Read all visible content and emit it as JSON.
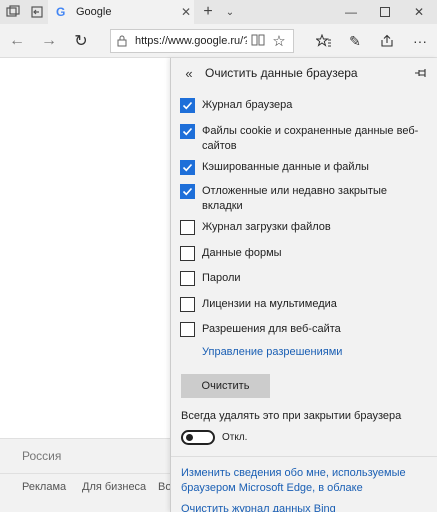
{
  "browser": {
    "tab": {
      "logo": "G",
      "title": "Google"
    },
    "address": {
      "url": "https://www.google.ru/?"
    }
  },
  "page": {
    "footer": {
      "country": "Россия",
      "links": [
        "Реклама",
        "Для бизнеса",
        "Во"
      ]
    }
  },
  "panel": {
    "title": "Очистить данные браузера",
    "checkboxes": [
      {
        "label": "Журнал браузера",
        "checked": true
      },
      {
        "label": "Файлы cookie и сохраненные данные веб-сайтов",
        "checked": true
      },
      {
        "label": "Кэшированные данные и файлы",
        "checked": true
      },
      {
        "label": "Отложенные или недавно закрытые вкладки",
        "checked": true
      },
      {
        "label": "Журнал загрузки файлов",
        "checked": false
      },
      {
        "label": "Данные формы",
        "checked": false
      },
      {
        "label": "Пароли",
        "checked": false
      },
      {
        "label": "Лицензии на мультимедиа",
        "checked": false
      },
      {
        "label": "Разрешения для веб-сайта",
        "checked": false
      }
    ],
    "manage_permissions_link": "Управление разрешениями",
    "clear_button": "Очистить",
    "always_clear_label": "Всегда удалять это при закрытии браузера",
    "toggle_state": "Откл.",
    "info_link": "Изменить сведения обо мне, используемые браузером Microsoft Edge, в облаке",
    "info_link2": "Очистить журнал данных Bing"
  },
  "colors": {
    "accent": "#1e6fd9",
    "link": "#1a5fb4"
  }
}
